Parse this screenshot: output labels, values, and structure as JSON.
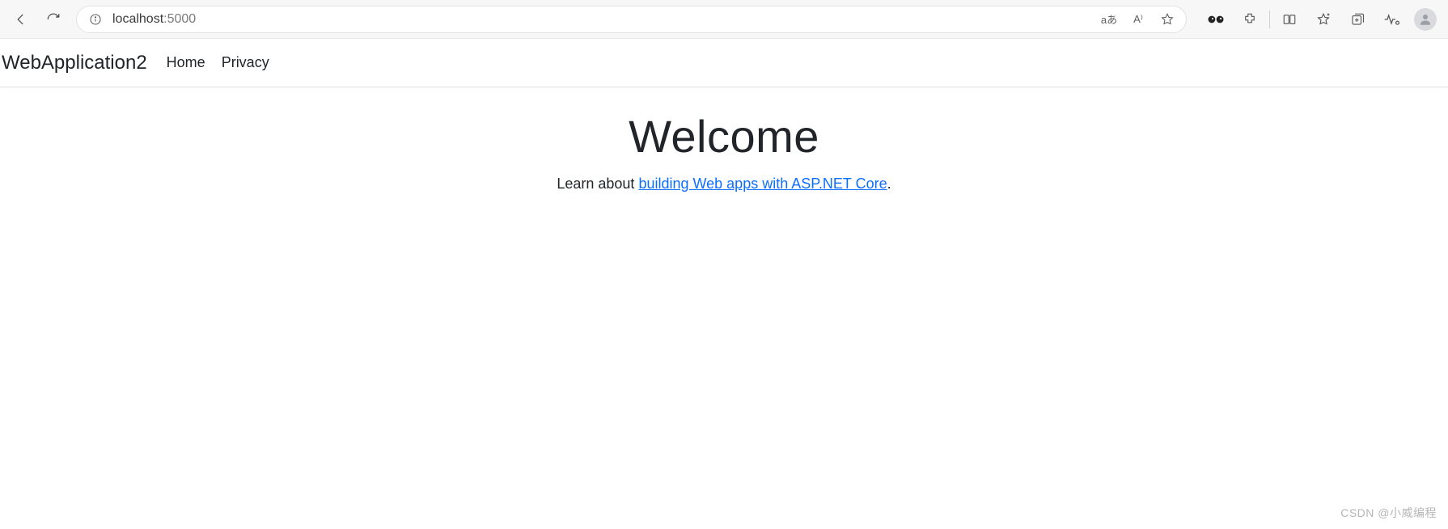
{
  "browser": {
    "url_host": "localhost",
    "url_port": ":5000",
    "translate_label": "aあ",
    "read_aloud_label": "A⁾"
  },
  "nav": {
    "brand": "WebApplication2",
    "links": [
      "Home",
      "Privacy"
    ]
  },
  "hero": {
    "title": "Welcome",
    "lead_prefix": "Learn about ",
    "lead_link": "building Web apps with ASP.NET Core",
    "lead_suffix": "."
  },
  "watermark": "CSDN @小威编程"
}
